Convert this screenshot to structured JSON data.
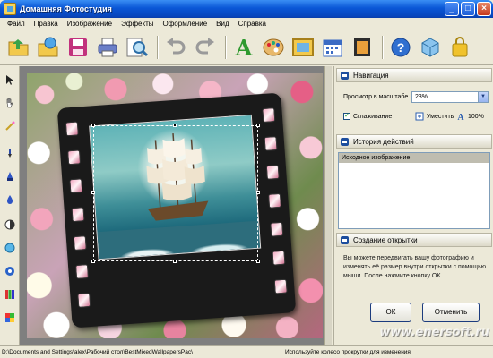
{
  "window": {
    "title": "Домашняя Фотостудия",
    "minimize": "_",
    "maximize": "□",
    "close": "×"
  },
  "menu": [
    "Файл",
    "Правка",
    "Изображение",
    "Эффекты",
    "Оформление",
    "Вид",
    "Справка"
  ],
  "toolbar": {
    "icons": [
      "open-folder-icon",
      "open-web-icon",
      "save-floppy-icon",
      "print-icon",
      "preview-zoom-icon",
      "undo-icon",
      "redo-icon",
      "add-text-icon",
      "palette-icon",
      "frame-icon",
      "calendar-icon",
      "postcard-icon",
      "help-icon",
      "box-icon",
      "bag-icon"
    ],
    "text_glyph": "A"
  },
  "left_tools": [
    "pointer-icon",
    "hand-icon",
    "magic-wand-icon",
    "brush-icon",
    "stamp-icon",
    "dropper-icon",
    "contrast-icon",
    "color-balance-icon",
    "hue-icon",
    "levels-icon",
    "palette-tool-icon"
  ],
  "navigation": {
    "header": "Навигация",
    "zoom_label": "Просмотр в масштабе",
    "zoom_value": "23%",
    "smoothing_label": "Сглаживание",
    "smoothing_checked": true,
    "fit_label": "Уместить",
    "actual_label": "100%"
  },
  "history": {
    "header": "История действий",
    "items": [
      "Исходное изображение"
    ]
  },
  "postcard": {
    "header": "Создание открытки",
    "description": "Вы можете передвигать вашу фотографию и изменять её размер внутри открытки с помощью мыши. После нажмите кнопку ОК.",
    "ok_label": "ОК",
    "cancel_label": "Отменить"
  },
  "status": {
    "path": "D:\\Documents and Settings\\alex\\Рабочий стол\\BestMixedWallpapersPac\\",
    "hint": "Используйте колесо прокрутки для изменения"
  },
  "watermark": "www.enersoft.ru",
  "colors": {
    "titlebar": "#0a57d6",
    "panel_bg": "#ece9d8",
    "selected_history": "#bfbdb0"
  }
}
